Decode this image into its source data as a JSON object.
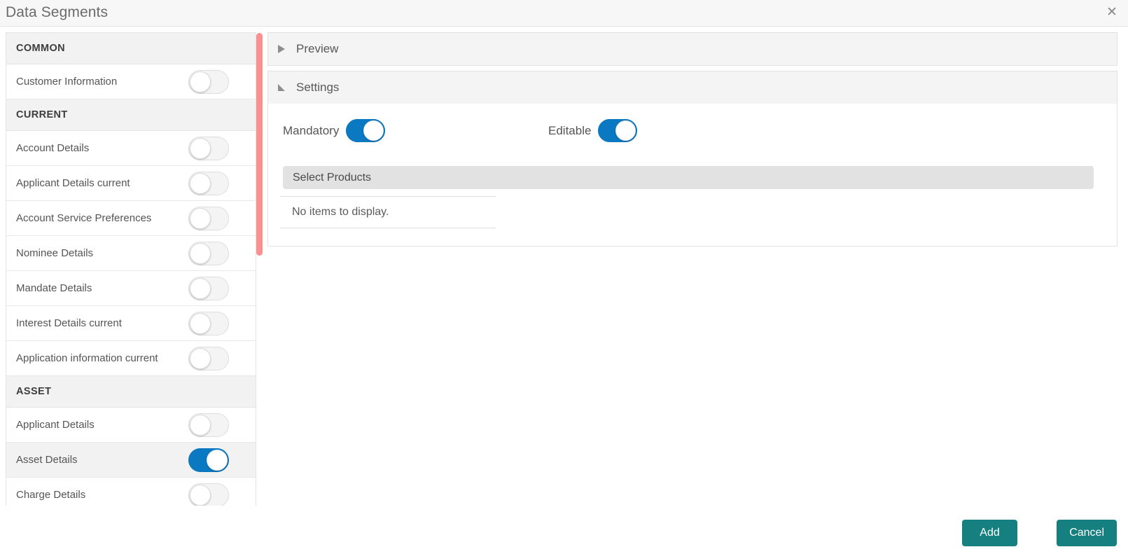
{
  "dialog": {
    "title": "Data Segments",
    "close_icon": "close-icon",
    "close_glyph": "✕"
  },
  "segments": {
    "groups": [
      {
        "name": "COMMON",
        "items": [
          {
            "label": "Customer Information",
            "enabled": false,
            "selected": false
          }
        ]
      },
      {
        "name": "CURRENT",
        "items": [
          {
            "label": "Account Details",
            "enabled": false,
            "selected": false
          },
          {
            "label": "Applicant Details current",
            "enabled": false,
            "selected": false
          },
          {
            "label": "Account Service Preferences",
            "enabled": false,
            "selected": false
          },
          {
            "label": "Nominee Details",
            "enabled": false,
            "selected": false
          },
          {
            "label": "Mandate Details",
            "enabled": false,
            "selected": false
          },
          {
            "label": "Interest Details current",
            "enabled": false,
            "selected": false
          },
          {
            "label": "Application information current",
            "enabled": false,
            "selected": false
          }
        ]
      },
      {
        "name": "ASSET",
        "items": [
          {
            "label": "Applicant Details",
            "enabled": false,
            "selected": false
          },
          {
            "label": "Asset Details",
            "enabled": true,
            "selected": true
          },
          {
            "label": "Charge Details",
            "enabled": false,
            "selected": false
          }
        ]
      }
    ],
    "scrollbar": {
      "color": "#fa9090"
    }
  },
  "detail": {
    "preview": {
      "title": "Preview",
      "expanded": false,
      "chevron_icon": "triangle-right-icon"
    },
    "settings": {
      "title": "Settings",
      "expanded": true,
      "chevron_icon": "triangle-down-icon",
      "mandatory": {
        "label": "Mandatory",
        "value": true
      },
      "editable": {
        "label": "Editable",
        "value": true
      },
      "products": {
        "header": "Select Products",
        "empty_message": "No items to display."
      }
    }
  },
  "footer": {
    "add_label": "Add",
    "cancel_label": "Cancel",
    "button_color": "#167f7f"
  },
  "colors": {
    "toggle_on": "#0b78c2",
    "scrollbar": "#fa9090",
    "accent_button": "#167f7f"
  }
}
